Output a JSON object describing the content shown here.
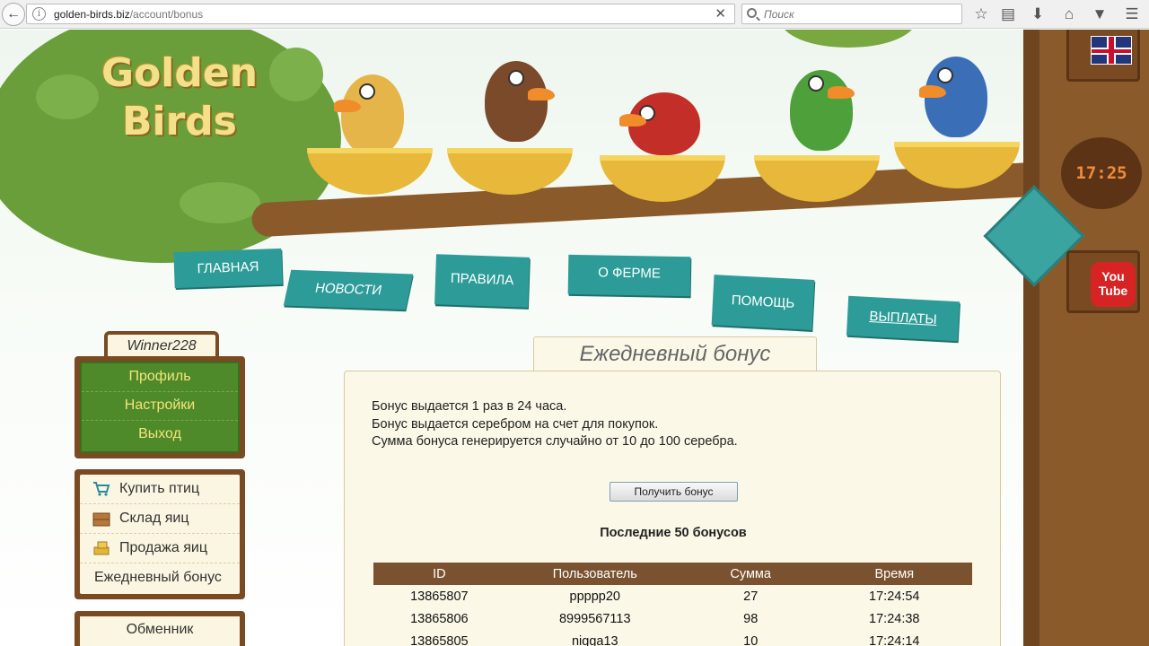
{
  "browser": {
    "url_domain": "golden-birds.biz",
    "url_path": "/account/bonus",
    "search_placeholder": "Поиск"
  },
  "header": {
    "logo_line1": "Golden",
    "logo_line2": "Birds",
    "clock": "17:25",
    "youtube_label_1": "You",
    "youtube_label_2": "Tube"
  },
  "nav": [
    {
      "label": "ГЛАВНАЯ"
    },
    {
      "label": "НОВОСТИ"
    },
    {
      "label": "ПРАВИЛА"
    },
    {
      "label": "О ФЕРМЕ"
    },
    {
      "label": "ПОМОЩЬ"
    },
    {
      "label": "ВЫПЛАТЫ"
    }
  ],
  "sidebar": {
    "username": "Winner228",
    "account_links": [
      {
        "label": "Профиль"
      },
      {
        "label": "Настройки"
      },
      {
        "label": "Выход"
      }
    ],
    "shop_links": [
      {
        "label": "Купить птиц",
        "icon": "cart-icon"
      },
      {
        "label": "Склад яиц",
        "icon": "crate-icon"
      },
      {
        "label": "Продажа яиц",
        "icon": "gold-bars-icon"
      },
      {
        "label": "Ежедневный бонус"
      }
    ],
    "exchanger": "Обменник"
  },
  "main": {
    "title": "Ежедневный бонус",
    "info_lines": [
      "Бонус выдается 1 раз в 24 часа.",
      "Бонус выдается серебром на счет для покупок.",
      "Сумма бонуса генерируется случайно от 10 до 100 серебра."
    ],
    "button_label": "Получить бонус",
    "last_title": "Последние 50 бонусов",
    "table": {
      "headers": [
        "ID",
        "Пользователь",
        "Сумма",
        "Время"
      ],
      "rows": [
        [
          "13865807",
          "ppppp20",
          "27",
          "17:24:54"
        ],
        [
          "13865806",
          "8999567113",
          "98",
          "17:24:38"
        ],
        [
          "13865805",
          "nigga13",
          "10",
          "17:24:14"
        ]
      ]
    }
  },
  "colors": {
    "teal": "#2d9c99",
    "wood": "#7a4a22",
    "green": "#4e8a2a",
    "cream": "#fbf8e8"
  }
}
